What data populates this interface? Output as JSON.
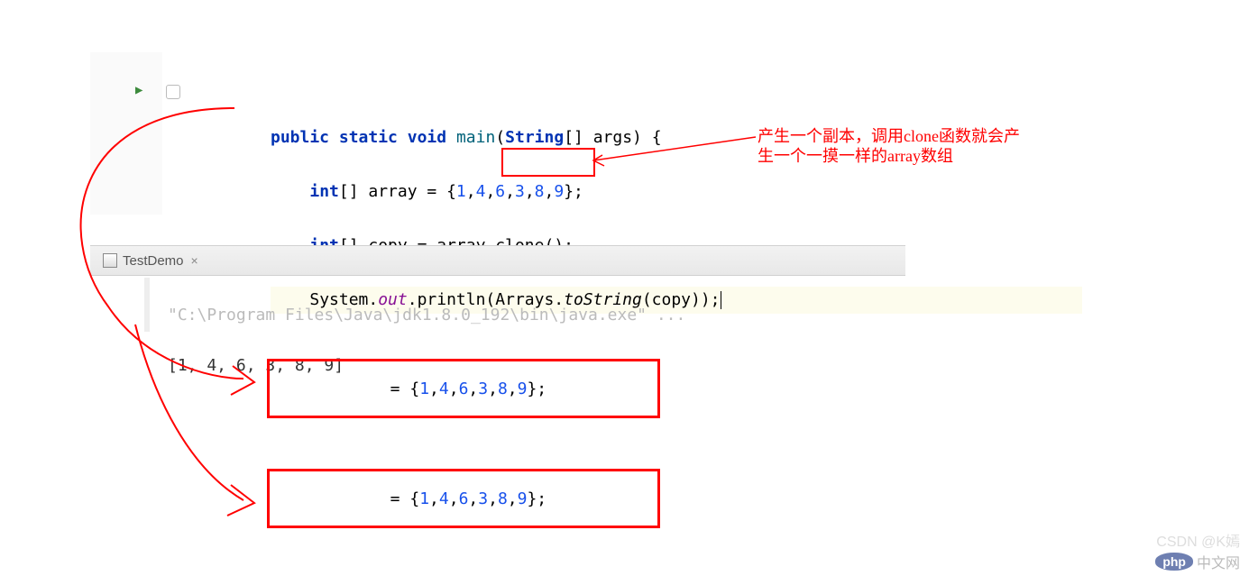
{
  "code": {
    "line1_public": "public",
    "line1_static": "static",
    "line1_void": "void",
    "line1_main": "main",
    "line1_paren_open": "(",
    "line1_string": "String",
    "line1_brackets": "[] args) {",
    "line2_int": "int",
    "line2_brackets": "[] array = {",
    "line2_n1": "1",
    "line2_c": ",",
    "line2_n2": "4",
    "line2_n3": "6",
    "line2_n4": "3",
    "line2_n5": "8",
    "line2_n6": "9",
    "line2_end": "};",
    "line3_int": "int",
    "line3_brackets": "[] copy = array",
    "line3_clone": ".clone()",
    "line3_semi": ";",
    "line4_sys": "System.",
    "line4_out": "out",
    "line4_println": ".println(Arrays.",
    "line4_tostring": "toString",
    "line4_end": "(copy));"
  },
  "annotation": {
    "line1": "产生一个副本，调用clone函数就会产",
    "line2": "生一个一摸一样的array数组"
  },
  "tab": {
    "name": "TestDemo",
    "close": "×"
  },
  "console": {
    "line1": "\"C:\\Program Files\\Java\\jdk1.8.0_192\\bin\\java.exe\" ...",
    "line2": "[1, 4, 6, 3, 8, 9]"
  },
  "resultBoxes": {
    "prefix": " = {",
    "n1": "1",
    "c": ",",
    "n2": "4",
    "n3": "6",
    "n4": "3",
    "n5": "8",
    "n6": "9",
    "suffix": "};"
  },
  "watermark": {
    "csdn": "CSDN @K嫣",
    "php_logo": "php",
    "php_text": "中文网"
  }
}
